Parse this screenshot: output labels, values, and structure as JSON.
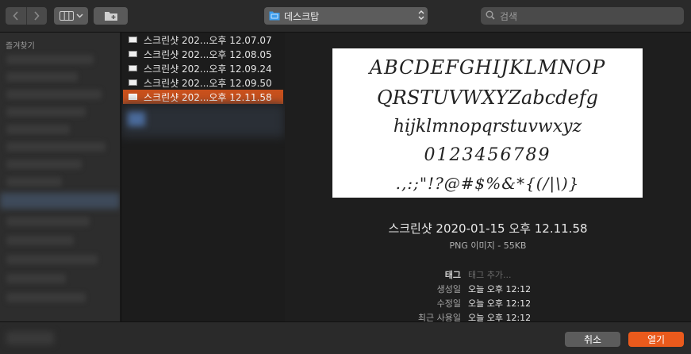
{
  "toolbar": {
    "location": "데스크탑",
    "search_placeholder": "검색"
  },
  "sidebar": {
    "title": "즐겨찾기"
  },
  "files": [
    {
      "name": "스크린샷 202...오후 12.07.07",
      "selected": false
    },
    {
      "name": "스크린샷 202...오후 12.08.05",
      "selected": false
    },
    {
      "name": "스크린샷 202...오후 12.09.24",
      "selected": false
    },
    {
      "name": "스크린샷 202...오후 12.09.50",
      "selected": false
    },
    {
      "name": "스크린샷 202...오후 12.11.58",
      "selected": true
    }
  ],
  "preview": {
    "image_lines": [
      "ABCDEFGHIJKLMNOP",
      "QRSTUVWXYZabcdefg",
      "hijklmnopqrstuvwxyz",
      "0123456789",
      ".,:;\"!?@#$%&*{(/|\\)}"
    ],
    "file_name": "스크린샷 2020-01-15 오후 12.11.58",
    "kind": "PNG 이미지 - 55KB",
    "meta": [
      {
        "label": "태그",
        "value": "태그 추가...",
        "placeholder": true
      },
      {
        "label": "생성일",
        "value": "오늘 오후 12:12",
        "placeholder": false
      },
      {
        "label": "수정일",
        "value": "오늘 오후 12:12",
        "placeholder": false
      },
      {
        "label": "최근 사용일",
        "value": "오늘 오후 12:12",
        "placeholder": false
      }
    ]
  },
  "footer": {
    "cancel_label": "취소",
    "open_label": "열기"
  }
}
